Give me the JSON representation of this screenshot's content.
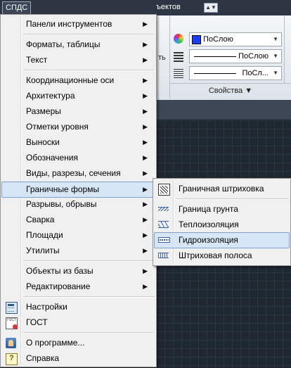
{
  "app_menu": {
    "label": "СПДС"
  },
  "background": {
    "tab_fragment": "ъектов",
    "dropdown_glyph": "▲▼",
    "ribbon_left_label": "ть",
    "color_select": "ПоСлою",
    "linetype_select": "ПоСлою",
    "lineweight_select": "ПоСл...",
    "panel_title": "Свойства",
    "panel_title_arrow": "▼",
    "select_arrow": "▼"
  },
  "main_menu": {
    "arrow_glyph": "▶",
    "items": [
      {
        "label": "Панели инструментов",
        "submenu": true
      },
      {
        "label": "Форматы, таблицы",
        "submenu": true
      },
      {
        "label": "Текст",
        "submenu": true
      },
      {
        "label": "Координационные оси",
        "submenu": true
      },
      {
        "label": "Архитектура",
        "submenu": true
      },
      {
        "label": "Размеры",
        "submenu": true
      },
      {
        "label": "Отметки уровня",
        "submenu": true
      },
      {
        "label": "Выноски",
        "submenu": true
      },
      {
        "label": "Обозначения",
        "submenu": true
      },
      {
        "label": "Виды, разрезы, сечения",
        "submenu": true
      },
      {
        "label": "Граничные формы",
        "submenu": true,
        "highlighted": true
      },
      {
        "label": "Разрывы, обрывы",
        "submenu": true
      },
      {
        "label": "Сварка",
        "submenu": true
      },
      {
        "label": "Площади",
        "submenu": true
      },
      {
        "label": "Утилиты",
        "submenu": true
      },
      {
        "label": "Объекты из базы",
        "submenu": true
      },
      {
        "label": "Редактирование",
        "submenu": true
      },
      {
        "label": "Настройки",
        "icon": "settings-icon"
      },
      {
        "label": "ГОСТ",
        "icon": "gost-icon"
      },
      {
        "label": "О программе...",
        "icon": "about-icon"
      },
      {
        "label": "Справка",
        "icon": "help-icon"
      }
    ]
  },
  "icons": {
    "gost_text": "ГОСТ",
    "help_glyph": "?"
  },
  "submenu": {
    "items": [
      {
        "label": "Граничная штриховка",
        "icon": "boundary-hatch-icon"
      },
      {
        "label": "Граница грунта",
        "icon": "ground-boundary-icon"
      },
      {
        "label": "Теплоизоляция",
        "icon": "thermal-insulation-icon"
      },
      {
        "label": "Гидроизоляция",
        "icon": "waterproofing-icon",
        "highlighted": true
      },
      {
        "label": "Штриховая полоса",
        "icon": "hatch-strip-icon"
      }
    ]
  }
}
